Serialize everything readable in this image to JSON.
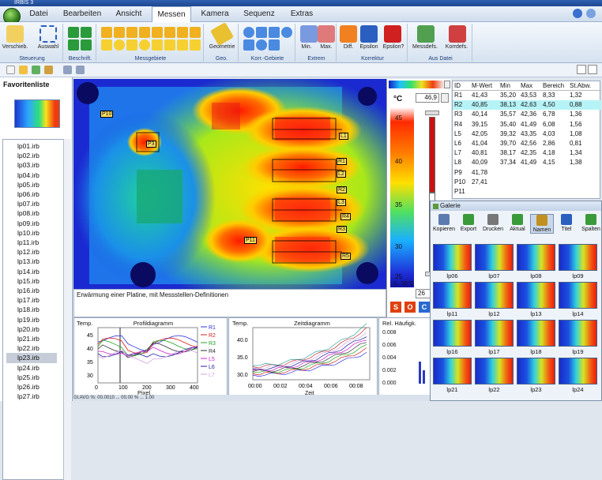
{
  "window": {
    "title": "IRBIS 3"
  },
  "menu": {
    "items": [
      "Datei",
      "Bearbeiten",
      "Ansicht",
      "Messen",
      "Kamera",
      "Sequenz",
      "Extras"
    ],
    "active": "Messen"
  },
  "ribbon": {
    "groups": [
      {
        "label": "Steuerung",
        "buttons": [
          "Verschieb.",
          "Auswahl"
        ]
      },
      {
        "label": "Beschrift.",
        "buttons": []
      },
      {
        "label": "Messgebiete",
        "buttons": []
      },
      {
        "label": "Geo.",
        "buttons": [
          "Geometrie"
        ]
      },
      {
        "label": "Korr.-Gebiete",
        "buttons": []
      },
      {
        "label": "Extrem",
        "buttons": [
          "Min.",
          "Max."
        ]
      },
      {
        "label": "Korrektur",
        "buttons": [
          "Diff.",
          "Epsilon",
          "Epsilon?"
        ]
      },
      {
        "label": "Aus Datei",
        "buttons": [
          "Messdefs.",
          "Korrdefs."
        ]
      }
    ]
  },
  "favorites": {
    "title": "Favoritenliste",
    "files": [
      "lp01.irb",
      "lp02.irb",
      "lp03.irb",
      "lp04.irb",
      "lp05.irb",
      "lp06.irb",
      "lp07.irb",
      "lp08.irb",
      "lp09.irb",
      "lp10.irb",
      "lp11.irb",
      "lp12.irb",
      "lp13.irb",
      "lp14.irb",
      "lp15.irb",
      "lp16.irb",
      "lp17.irb",
      "lp18.irb",
      "lp19.irb",
      "lp20.irb",
      "lp21.irb",
      "lp22.irb",
      "lp23.irb",
      "lp24.irb",
      "lp25.irb",
      "lp26.irb",
      "lp27.irb"
    ],
    "selected": "lp23.irb"
  },
  "image": {
    "caption": "Erwärmung einer Platine, mit Messstellen-Definitionen",
    "markers": [
      "P10",
      "P3",
      "L1",
      "L2",
      "L3",
      "R1",
      "R2",
      "R3",
      "R4",
      "R5",
      "P11"
    ]
  },
  "scale": {
    "unit": "°C",
    "max_value": "46,9",
    "min_value": "26",
    "ticks": [
      "45",
      "40",
      "35",
      "30",
      "25"
    ],
    "bottom_label": "0.. 50°C",
    "buttons": [
      "S",
      "O",
      "C"
    ]
  },
  "table": {
    "headers": [
      "ID",
      "M-Wert",
      "Min",
      "Max",
      "Bereich",
      "St.Abw."
    ],
    "rows": [
      [
        "R1",
        "41,43",
        "35,20",
        "43,53",
        "8,33",
        "1,32"
      ],
      [
        "R2",
        "40,85",
        "38,13",
        "42,63",
        "4,50",
        "0,88"
      ],
      [
        "R3",
        "40,14",
        "35,57",
        "42,36",
        "6,78",
        "1,36"
      ],
      [
        "R4",
        "39,15",
        "35,40",
        "41,49",
        "6,08",
        "1,56"
      ],
      [
        "L5",
        "42,05",
        "39,32",
        "43,35",
        "4,03",
        "1,08"
      ],
      [
        "L6",
        "41,04",
        "39,70",
        "42,56",
        "2,86",
        "0,81"
      ],
      [
        "L7",
        "40,81",
        "38,17",
        "42,35",
        "4,18",
        "1,34"
      ],
      [
        "L8",
        "40,09",
        "37,34",
        "41,49",
        "4,15",
        "1,38"
      ],
      [
        "P9",
        "41,78",
        "",
        "",
        "",
        ""
      ],
      [
        "P10",
        "27,41",
        "",
        "",
        "",
        ""
      ],
      [
        "P11",
        "",
        "",
        "",
        "",
        ""
      ]
    ],
    "highlight_row": 1
  },
  "gallery": {
    "title": "Galerie",
    "tools": [
      "Kopieren",
      "Export",
      "Drucken",
      "Aktual",
      "Namen",
      "Titel",
      "Spalten"
    ],
    "thumbs": [
      "lp06",
      "lp07",
      "lp08",
      "lp09",
      "lp11",
      "lp12",
      "lp13",
      "lp14",
      "lp16",
      "lp17",
      "lp18",
      "lp19",
      "lp21",
      "lp22",
      "lp23",
      "lp24"
    ]
  },
  "profile": {
    "ylabel": "Temp.",
    "title": "Profildiagramm",
    "xlabel": "Pixel",
    "yticks": [
      "45",
      "40",
      "35",
      "30"
    ],
    "xticks": [
      "0",
      "100",
      "200",
      "300",
      "400"
    ],
    "legend": [
      "R1",
      "R2",
      "R3",
      "R4",
      "L5",
      "L6",
      "L7"
    ],
    "legend_colors": [
      "#3030e0",
      "#d02020",
      "#20a020",
      "#303030",
      "#d020d0",
      "#2020a0",
      "#d0a0e0"
    ]
  },
  "timechart": {
    "ylabel": "Temp.",
    "title": "Zeitdiagramm",
    "xlabel": "Zeit",
    "yticks": [
      "40.0",
      "35.0",
      "30.0"
    ],
    "xticks": [
      "00:00",
      "00:02",
      "00:04",
      "00:06",
      "00:08"
    ]
  },
  "histogram": {
    "title": "Rel. Häufigk.",
    "yticks": [
      "0.008",
      "0.006",
      "0.004",
      "0.002",
      "0.000"
    ]
  },
  "statusbar": {
    "text": "Gl.AVG %: 00.0010 ... 00.00 % ... 1.00"
  }
}
